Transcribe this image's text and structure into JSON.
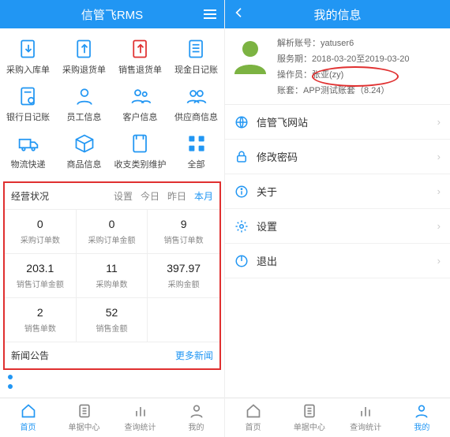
{
  "left": {
    "header_title": "信管飞RMS",
    "grid": [
      {
        "label": "采购入库单",
        "name": "purchase-in"
      },
      {
        "label": "采购退货单",
        "name": "purchase-return"
      },
      {
        "label": "销售退货单",
        "name": "sales-return"
      },
      {
        "label": "现金日记账",
        "name": "cash-journal"
      },
      {
        "label": "银行日记账",
        "name": "bank-journal"
      },
      {
        "label": "员工信息",
        "name": "employee-info"
      },
      {
        "label": "客户信息",
        "name": "customer-info"
      },
      {
        "label": "供应商信息",
        "name": "supplier-info"
      },
      {
        "label": "物流快递",
        "name": "logistics"
      },
      {
        "label": "商品信息",
        "name": "product-info"
      },
      {
        "label": "收支类别维护",
        "name": "category-maint"
      },
      {
        "label": "全部",
        "name": "all"
      }
    ],
    "status_title": "经营状况",
    "status_links": {
      "settings": "设置",
      "today": "今日",
      "yesterday": "昨日",
      "month": "本月"
    },
    "stats": [
      {
        "value": "0",
        "label": "采购订单数"
      },
      {
        "value": "0",
        "label": "采购订单金额"
      },
      {
        "value": "9",
        "label": "销售订单数"
      },
      {
        "value": "203.1",
        "label": "销售订单金额"
      },
      {
        "value": "11",
        "label": "采购单数"
      },
      {
        "value": "397.97",
        "label": "采购金额"
      },
      {
        "value": "2",
        "label": "销售单数"
      },
      {
        "value": "52",
        "label": "销售金额"
      },
      {
        "value": "",
        "label": ""
      }
    ],
    "news_title": "新闻公告",
    "news_more": "更多新闻",
    "tabs": [
      {
        "label": "首页",
        "name": "home",
        "active": true
      },
      {
        "label": "单据中心",
        "name": "orders",
        "active": false
      },
      {
        "label": "查询统计",
        "name": "stats",
        "active": false
      },
      {
        "label": "我的",
        "name": "mine",
        "active": false
      }
    ]
  },
  "right": {
    "header_title": "我的信息",
    "profile": {
      "account_label": "解析账号：",
      "account": "yatuser6",
      "period_label": "服务期：",
      "period": "2018-03-20至2019-03-20",
      "operator_label": "操作员：",
      "operator": "张亚(zy)",
      "book_label": "账套：",
      "book": "APP测试账套（8.24）"
    },
    "menu": [
      {
        "label": "信管飞网站",
        "name": "website"
      },
      {
        "label": "修改密码",
        "name": "change-password"
      },
      {
        "label": "关于",
        "name": "about"
      },
      {
        "label": "设置",
        "name": "settings"
      },
      {
        "label": "退出",
        "name": "logout"
      }
    ],
    "tabs": [
      {
        "label": "首页",
        "name": "home",
        "active": false
      },
      {
        "label": "单据中心",
        "name": "orders",
        "active": false
      },
      {
        "label": "查询统计",
        "name": "stats",
        "active": false
      },
      {
        "label": "我的",
        "name": "mine",
        "active": true
      }
    ]
  }
}
